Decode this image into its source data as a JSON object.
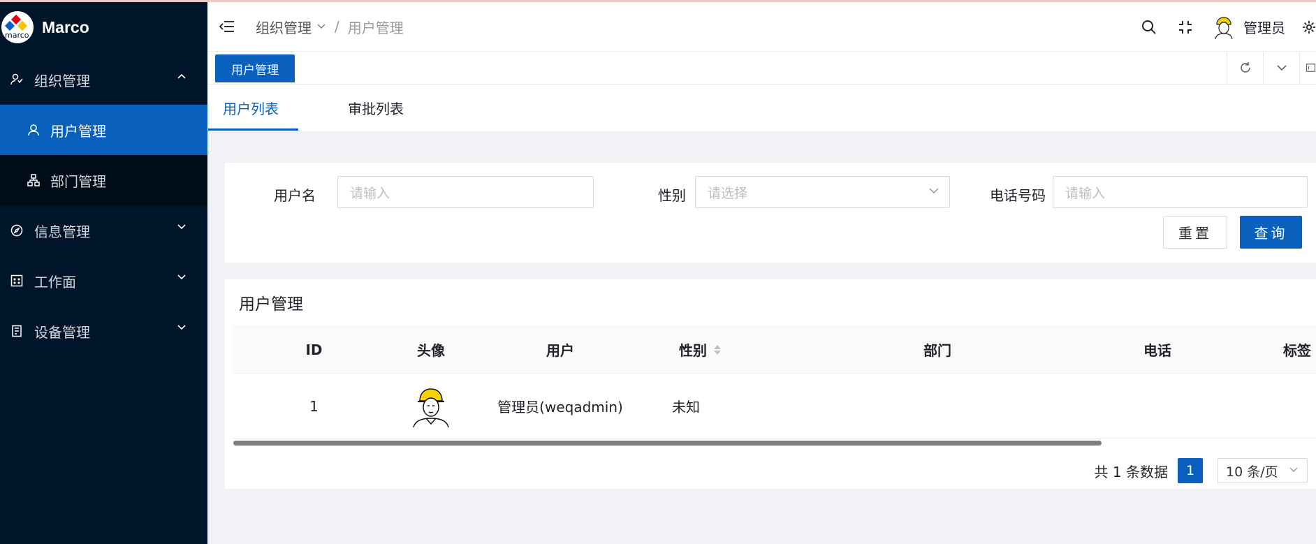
{
  "app": {
    "title": "Marco",
    "logo_text": "marco"
  },
  "sidebar": {
    "groups": [
      {
        "label": "组织管理",
        "expanded": true,
        "icon": "org-icon",
        "children": [
          {
            "label": "用户管理",
            "icon": "user-icon",
            "active": true
          },
          {
            "label": "部门管理",
            "icon": "department-icon",
            "active": false
          }
        ]
      },
      {
        "label": "信息管理",
        "expanded": false,
        "icon": "compass-icon"
      },
      {
        "label": "工作面",
        "expanded": false,
        "icon": "grid-icon"
      },
      {
        "label": "设备管理",
        "expanded": false,
        "icon": "device-icon"
      }
    ]
  },
  "header": {
    "breadcrumb": [
      "组织管理",
      "用户管理"
    ],
    "separator": "/",
    "user_name": "管理员"
  },
  "tabs": {
    "page_tab": "用户管理"
  },
  "subtabs": [
    "用户列表",
    "审批列表"
  ],
  "search": {
    "username_label": "用户名",
    "username_placeholder": "请输入",
    "gender_label": "性别",
    "gender_placeholder": "请选择",
    "phone_label": "电话号码",
    "phone_placeholder": "请输入",
    "reset_label": "重置",
    "query_label": "查询"
  },
  "table": {
    "title": "用户管理",
    "columns": [
      "ID",
      "头像",
      "用户",
      "性别",
      "部门",
      "电话",
      "标签"
    ],
    "rows": [
      {
        "id": "1",
        "user": "管理员(weqadmin)",
        "gender": "未知",
        "department": "",
        "phone": "",
        "tags": ""
      }
    ]
  },
  "pagination": {
    "total_text": "共 1 条数据",
    "current_page": "1",
    "page_size": "10 条/页"
  },
  "colors": {
    "primary": "#0960bd",
    "sidebar_bg": "#001529",
    "submenu_bg": "#000c17"
  }
}
